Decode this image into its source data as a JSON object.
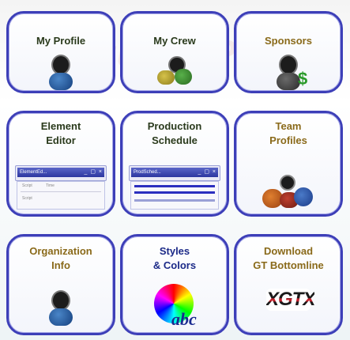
{
  "tiles": {
    "my_profile": {
      "label": "My Profile"
    },
    "my_crew": {
      "label": "My Crew"
    },
    "sponsors": {
      "label": "Sponsors"
    },
    "element_editor": {
      "line1": "Element",
      "line2": "Editor",
      "mini_title": "ElementEd...",
      "field1": "Script",
      "field2": "Time",
      "field3": "Script"
    },
    "production_schedule": {
      "line1": "Production",
      "line2": "Schedule",
      "mini_title": "ProdSched..."
    },
    "team_profiles": {
      "line1": "Team",
      "line2": "Profiles"
    },
    "organization_info": {
      "line1": "Organization",
      "line2": "Info"
    },
    "styles_colors": {
      "line1": "Styles",
      "line2": "& Colors",
      "badge": "abc"
    },
    "download_bottomline": {
      "line1": "Download",
      "line2": "GT Bottomline",
      "logo": "XGTX"
    }
  },
  "watermark": "GTStudio Pro",
  "colors": {
    "border": "#3d3fb8",
    "profile_title": "#2a3a1c",
    "gold_title": "#8a6a1a",
    "blue_title": "#1c2a88"
  },
  "icons": [
    "person-icon",
    "crew-icon",
    "sponsor-person-icon",
    "dollar-icon",
    "window-icon",
    "schedule-window-icon",
    "team-avatars-icon",
    "color-wheel-icon",
    "bottomline-logo-icon"
  ]
}
